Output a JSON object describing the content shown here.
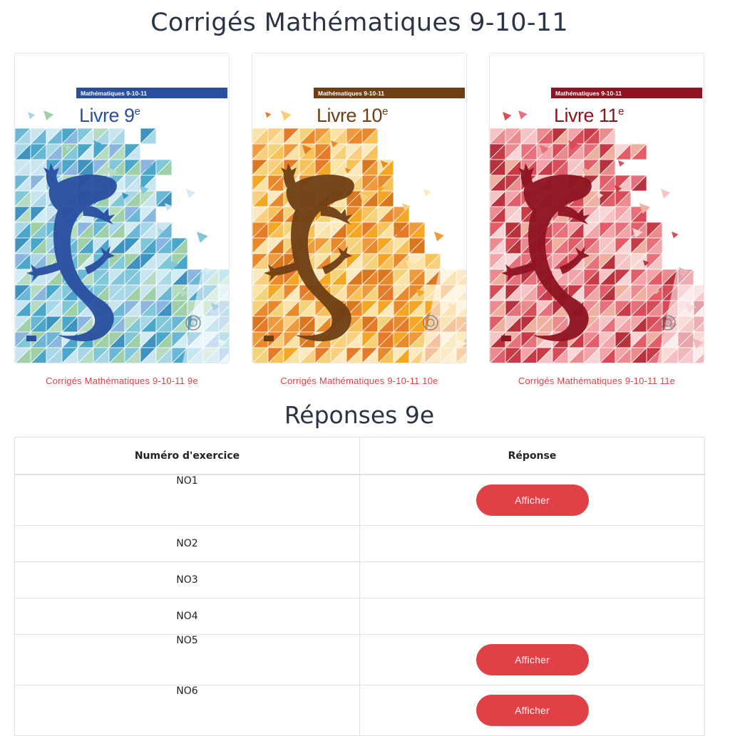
{
  "page": {
    "title": "Corrigés Mathématiques 9-10-11"
  },
  "colors": {
    "accent": "#e04147",
    "heading": "#2b3445",
    "book9": "#2a4fa0",
    "book10": "#6e3f14",
    "book11": "#8e1421"
  },
  "books": [
    {
      "series": "Mathématiques 9-10-11",
      "cover_title": "Livre 9",
      "sup": "e",
      "link": "Corrigés Mathématiques 9-10-11 9e",
      "color": "#2a4fa0",
      "icon": "gecko-icon"
    },
    {
      "series": "Mathématiques 9-10-11",
      "cover_title": "Livre 10",
      "sup": "e",
      "link": "Corrigés Mathématiques 9-10-11 10e",
      "color": "#6e3f14",
      "icon": "gecko-icon"
    },
    {
      "series": "Mathématiques 9-10-11",
      "cover_title": "Livre 11",
      "sup": "e",
      "link": "Corrigés Mathématiques 9-10-11 11e",
      "color": "#8e1421",
      "icon": "gecko-icon"
    }
  ],
  "answers": {
    "title": "Réponses 9e",
    "headers": {
      "number": "Numéro d'exercice",
      "answer": "Réponse"
    },
    "rows": [
      {
        "number": "NO1",
        "button": "Afficher"
      },
      {
        "number": "NO2",
        "button": ""
      },
      {
        "number": "NO3",
        "button": ""
      },
      {
        "number": "NO4",
        "button": ""
      },
      {
        "number": "NO5",
        "button": "Afficher"
      },
      {
        "number": "NO6",
        "button": "Afficher"
      }
    ]
  }
}
